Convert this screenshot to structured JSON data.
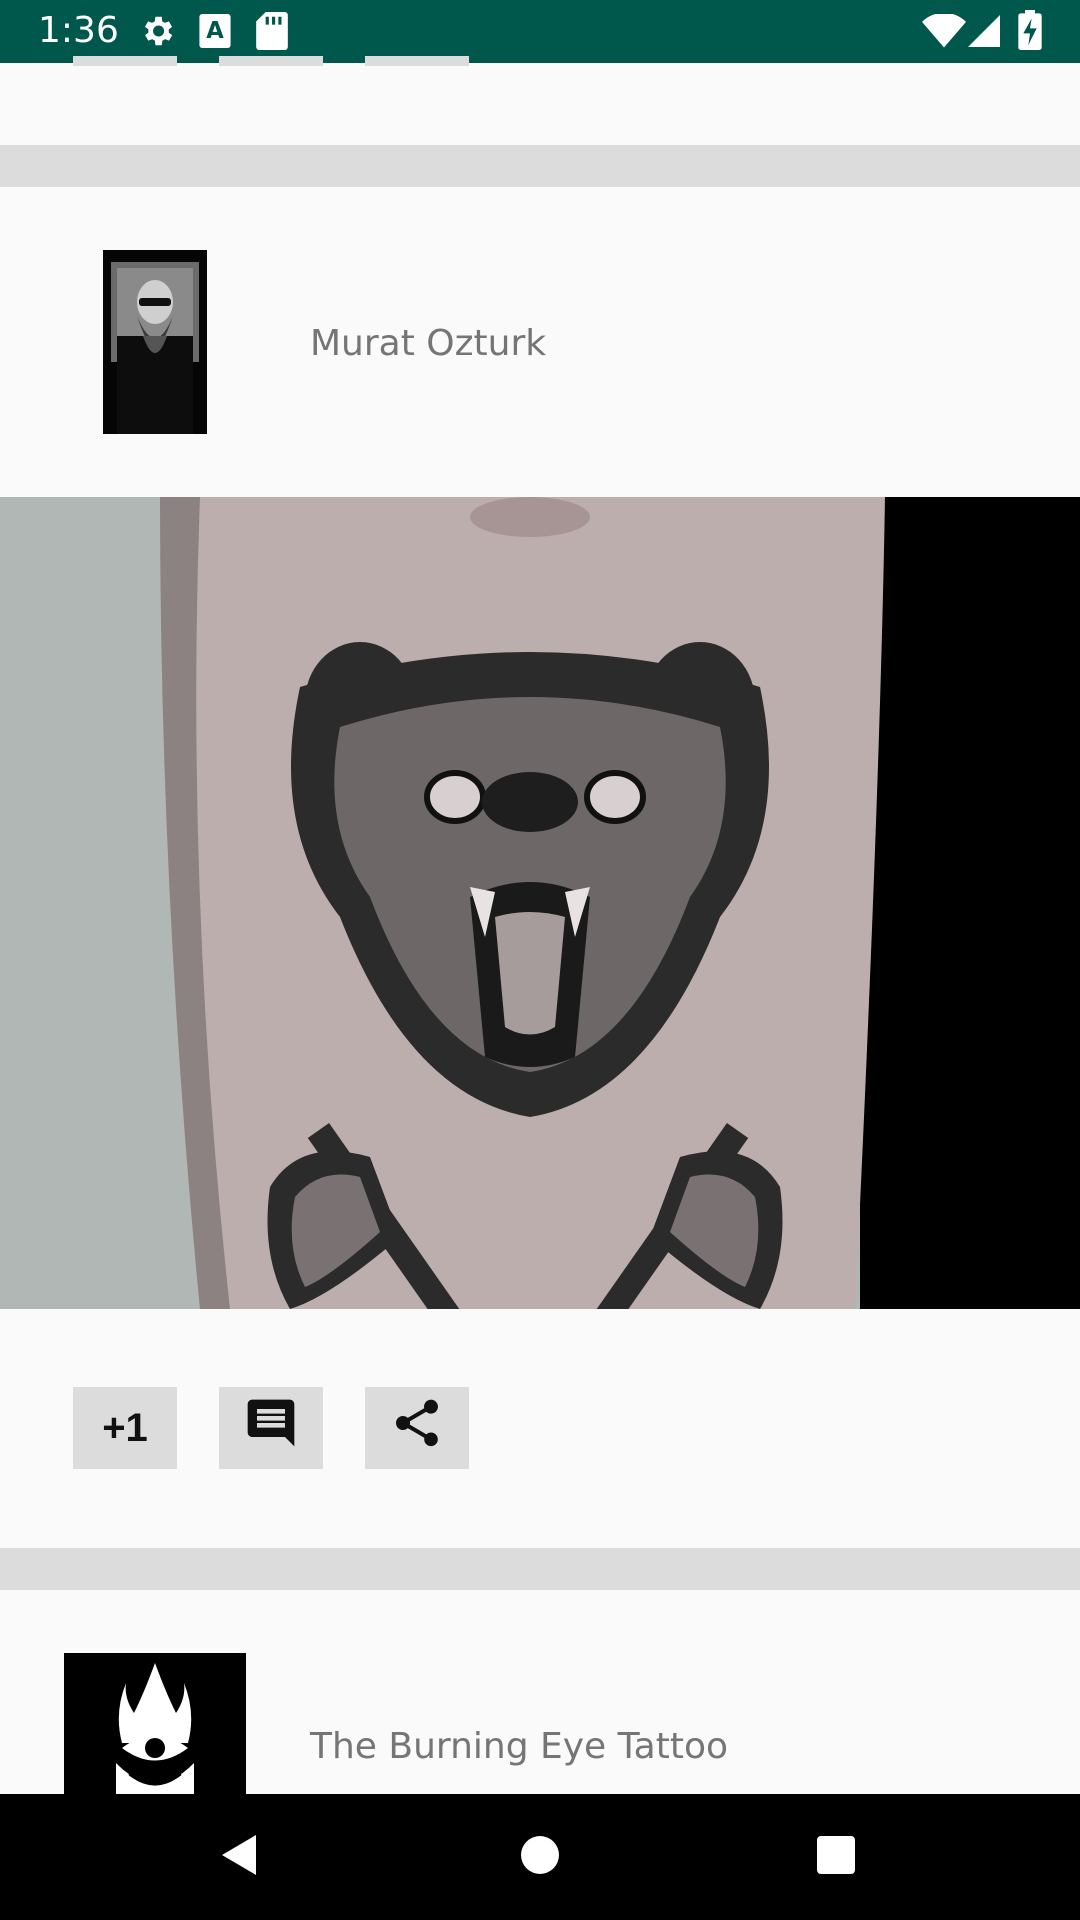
{
  "status_bar": {
    "time": "1:36",
    "icons": [
      "gear-icon",
      "font-a-icon",
      "sd-card-icon",
      "wifi-icon",
      "signal-icon",
      "battery-charging-icon"
    ]
  },
  "feed": {
    "posts": [
      {
        "author": "Murat Ozturk",
        "image_subject": "bear head tattoo with crossed axes",
        "actions": {
          "plus_one_label": "+1",
          "comment_icon": "comment-icon",
          "share_icon": "share-icon"
        }
      },
      {
        "author": "The Burning Eye Tattoo"
      }
    ]
  },
  "nav_bar": {
    "icons": [
      "back-icon",
      "home-icon",
      "recents-icon"
    ]
  },
  "colors": {
    "status_bar": "#00574b",
    "background": "#fafafa",
    "divider": "#dcdcdc",
    "button_bg": "#dcdcdc",
    "author_text": "#757575",
    "nav_bar": "#000000"
  }
}
